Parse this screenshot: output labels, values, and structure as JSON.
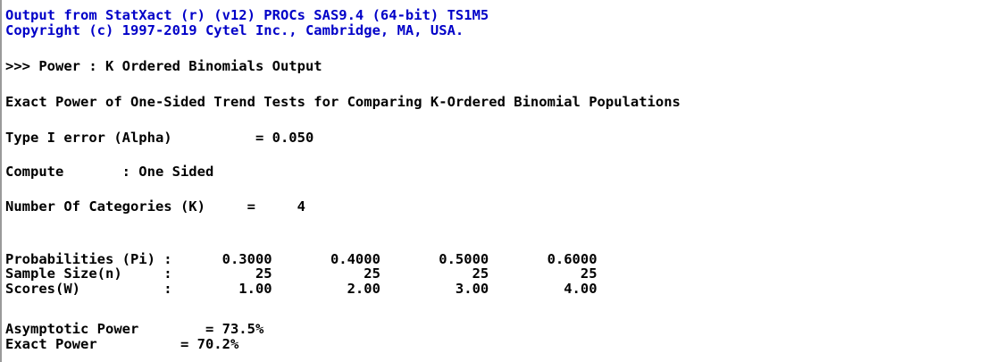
{
  "header": {
    "line1": "Output from StatXact (r) (v12) PROCs SAS9.4 (64-bit) TS1M5",
    "line2": "Copyright (c) 1997-2019 Cytel Inc., Cambridge, MA, USA."
  },
  "section_title": ">>> Power : K Ordered Binomials Output",
  "report_title": "Exact Power of One-Sided Trend Tests for Comparing K-Ordered Binomial Populations",
  "settings": {
    "alpha_line": "Type I error (Alpha)          = 0.050",
    "compute_line": "Compute       : One Sided",
    "categories_line": "Number Of Categories (K)     =     4"
  },
  "table": {
    "probabilities_line": "Probabilities (Pi) :      0.3000       0.4000       0.5000       0.6000",
    "sample_size_line": "Sample Size(n)     :          25           25           25           25",
    "scores_line": "Scores(W)          :        1.00         2.00         3.00         4.00"
  },
  "results": {
    "asymptotic_line": "Asymptotic Power        = 73.5%",
    "exact_line": "Exact Power          = 70.2%"
  },
  "colors": {
    "header_text": "#0000c8",
    "body_text": "#000000",
    "background": "#ffffff"
  }
}
